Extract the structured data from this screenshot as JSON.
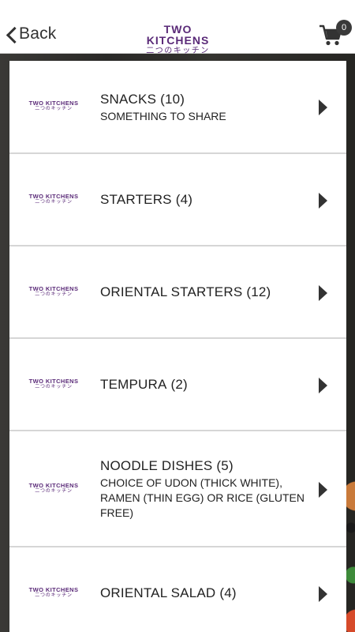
{
  "header": {
    "back_label": "Back",
    "brand_en": "TWO KITCHENS",
    "brand_jp": "二つのキッチン",
    "cart_count": "0"
  },
  "categories": [
    {
      "name": "SNACKS",
      "count": "(10)",
      "subtitle": "SOMETHING TO SHARE"
    },
    {
      "name": "STARTERS",
      "count": "(4)",
      "subtitle": ""
    },
    {
      "name": "ORIENTAL STARTERS",
      "count": "(12)",
      "subtitle": ""
    },
    {
      "name": "TEMPURA",
      "count": "(2)",
      "subtitle": ""
    },
    {
      "name": "NOODLE DISHES",
      "count": "(5)",
      "subtitle": "CHOICE OF UDON (THICK WHITE), RAMEN (THIN EGG) OR RICE (GLUTEN FREE)"
    },
    {
      "name": "ORIENTAL SALAD",
      "count": "(4)",
      "subtitle": ""
    }
  ],
  "item_logo": {
    "en": "TWO KITCHENS",
    "jp": "二つのキッチン"
  },
  "colors": {
    "brand": "#5a2a78",
    "text": "#222222",
    "divider": "#d6d6d6"
  },
  "icons": {
    "back": "chevron-left-icon",
    "cart": "shopping-cart-icon",
    "row": "play-arrow-icon"
  }
}
